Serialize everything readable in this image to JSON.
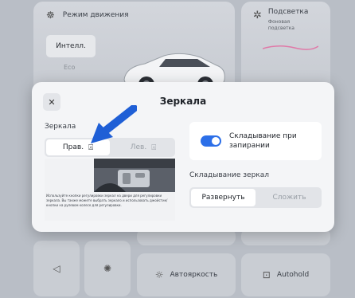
{
  "dashboard": {
    "drive_mode_label": "Режим движения",
    "intel_button": "Интелл.",
    "eco_label": "Eco",
    "lighting_title": "Подсветка",
    "lighting_sub_1": "Фоновая",
    "lighting_sub_2": "подсветка",
    "auto_brightness": "Автояркость",
    "autohold": "Autohold"
  },
  "modal": {
    "title": "Зеркала",
    "close_glyph": "✕",
    "mirrors_label": "Зеркала",
    "mirror_options": [
      "Прав.",
      "Лев."
    ],
    "mirror_selected": "Прав.",
    "preview_text": "Используйте кнопки регулировки зеркал на двери для регулировки зеркала. Вы также можете выбрать зеркало и использовать джойстик/кнопки на рулевом колесе для регулировки.",
    "fold_on_lock_label": "Складывание при запирании",
    "fold_on_lock_enabled": true,
    "fold_mirrors_label": "Складывание зеркал",
    "fold_options": [
      "Развернуть",
      "Сложить"
    ],
    "fold_selected": "Развернуть"
  },
  "colors": {
    "accent": "#2c6fe8",
    "arrow": "#1f5fd6"
  }
}
